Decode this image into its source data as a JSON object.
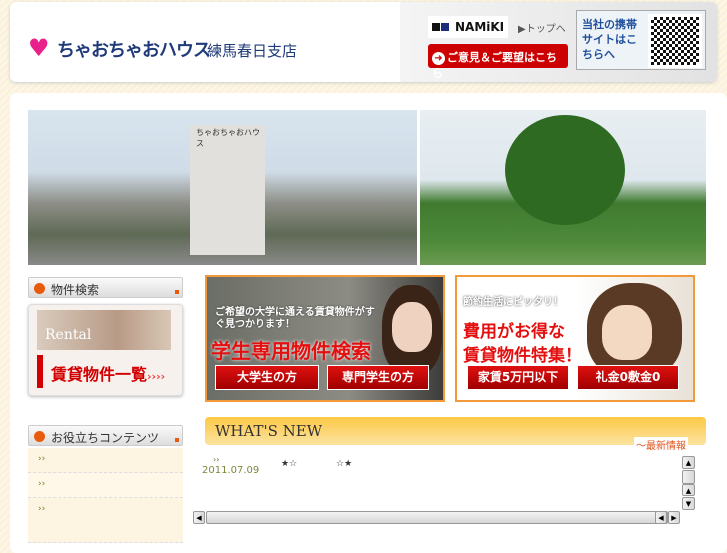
{
  "header": {
    "logo_text": "ちゃおちゃおハウス",
    "branch": "練馬春日支店",
    "namiki": "NAMiKI",
    "top_link": "トップへ",
    "opinion_button": "ご意見＆ご要望はこちら",
    "mobile_site": "当社の携帯サイトはこちらへ"
  },
  "photos": {
    "building_sign": "ちゃおちゃおハウス"
  },
  "sidebar": {
    "search_heading": "物件検索",
    "rental_en": "Rental",
    "rental_jp": "賃貸物件一覧",
    "rental_arrows": "››››",
    "useful_heading": "お役立ちコンテンツ",
    "useful_items": [
      "››",
      "››",
      "››"
    ]
  },
  "banners": {
    "student": {
      "sub": "ご希望の大学に通える賃貸物件がすぐ見つかります！",
      "title": "学生専用物件検索",
      "buttons": [
        "大学生の方",
        "専門学生の方"
      ]
    },
    "cheap": {
      "sub": "節約生活にピッタリ！",
      "title1": "費用がお得な",
      "title2": "賃貸物件特集！",
      "buttons": [
        "家賃5万円以下",
        "礼金0敷金0"
      ]
    }
  },
  "whats_new": {
    "title": "WHAT'S NEW",
    "subtitle": "～最新情報",
    "items": [
      {
        "marker": "››",
        "date": "2011.07.09",
        "stars1": "★☆",
        "stars2": "☆★"
      }
    ]
  }
}
